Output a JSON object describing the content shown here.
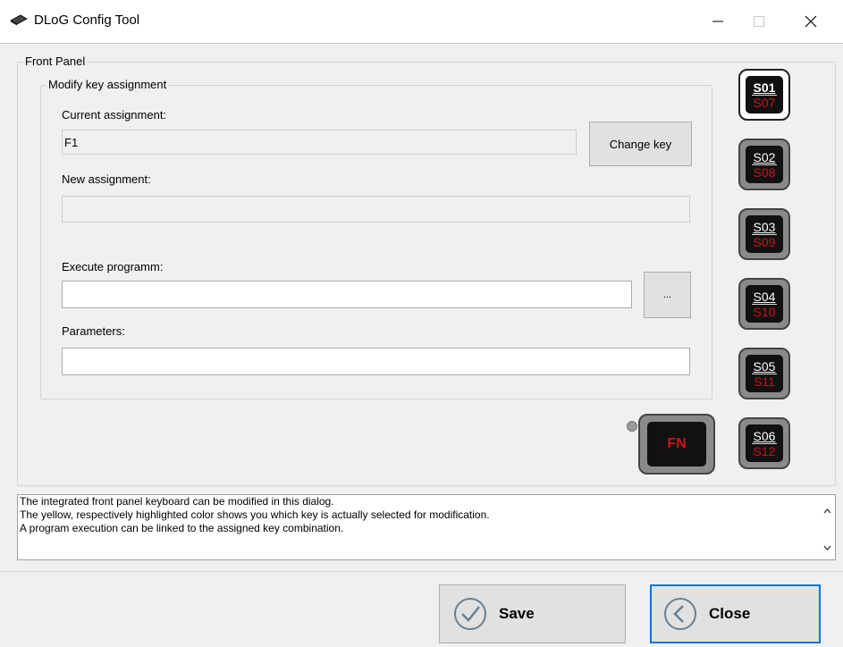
{
  "window": {
    "title": "DLoG Config Tool",
    "icon": "keyboard-app-icon"
  },
  "front_panel": {
    "title": "Front Panel",
    "modify": {
      "title": "Modify key assignment",
      "current_label": "Current assignment:",
      "current_value": "F1",
      "change_key_label": "Change key",
      "new_label": "New assignment:",
      "new_value": "",
      "execute_label": "Execute programm:",
      "execute_value": "",
      "browse_label": "...",
      "params_label": "Parameters:",
      "params_value": ""
    },
    "keys": [
      {
        "top": "S01",
        "bottom": "S07",
        "selected": true
      },
      {
        "top": "S02",
        "bottom": "S08",
        "selected": false
      },
      {
        "top": "S03",
        "bottom": "S09",
        "selected": false
      },
      {
        "top": "S04",
        "bottom": "S10",
        "selected": false
      },
      {
        "top": "S05",
        "bottom": "S11",
        "selected": false
      },
      {
        "top": "S06",
        "bottom": "S12",
        "selected": false
      }
    ],
    "fn_key": "FN"
  },
  "info": {
    "lines": [
      "The integrated front panel keyboard can be modified in this dialog.",
      "The yellow, respectively highlighted color shows you which key is actually selected for modification.",
      "A program execution can be linked to the assigned key combination."
    ]
  },
  "buttons": {
    "save": "Save",
    "close": "Close"
  },
  "colors": {
    "key_red": "#c8141e",
    "focus_blue": "#0078d7"
  }
}
